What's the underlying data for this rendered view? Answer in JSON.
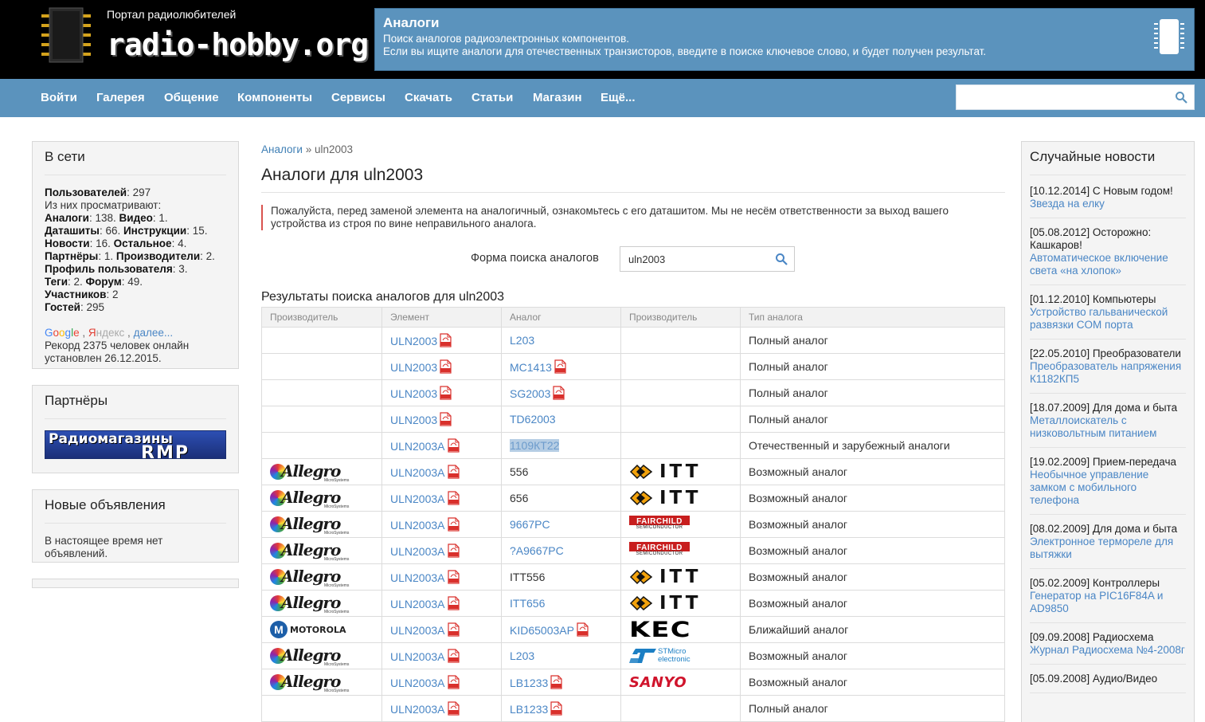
{
  "header": {
    "tagline": "Портал радиолюбителей",
    "site_name": "radio-hobby.org",
    "info_title": "Аналоги",
    "info_line1": "Поиск аналогов радиоэлектронных компонентов.",
    "info_line2": "Если вы ищите аналоги для отечественных транзисторов, введите в поиске ключевое слово, и будет получен результат."
  },
  "nav": {
    "items": [
      "Войти",
      "Галерея",
      "Общение",
      "Компоненты",
      "Сервисы",
      "Скачать",
      "Статьи",
      "Магазин",
      "Ещё..."
    ],
    "search_value": ""
  },
  "online": {
    "title": "В сети",
    "users_label": "Пользователей",
    "users": ": 297",
    "viewing": "Из них просматривают:",
    "l1a": "Аналоги",
    "l1b": ": 138. ",
    "l1c": "Видео",
    "l1d": ": 1.",
    "l2a": "Даташиты",
    "l2b": ": 66. ",
    "l2c": "Инструкции",
    "l2d": ": 15.",
    "l3a": "Новости",
    "l3b": ": 16. ",
    "l3c": "Остальное",
    "l3d": ": 4.",
    "l4a": "Партнёры",
    "l4b": ": 1. ",
    "l4c": "Производители",
    "l4d": ": 2.",
    "l5a": "Профиль пользователя",
    "l5b": ": 3.",
    "l6a": "Теги",
    "l6b": ": 2. ",
    "l6c": "Форум",
    "l6d": ": 49.",
    "l7a": "Участников",
    "l7b": ": 2",
    "l8a": "Гостей",
    "l8b": ": 295",
    "google": "Google",
    "yandex": "Яндекс",
    "more": "далее...",
    "record": "Рекорд 2375 человек онлайн установлен 26.12.2015."
  },
  "partners": {
    "title": "Партнёры",
    "banner_text": "Радиомагазины",
    "banner_sub": "RMP"
  },
  "ads": {
    "title": "Новые объявления",
    "text": "В настоящее время нет объявлений."
  },
  "breadcrumb": {
    "link": "Аналоги",
    "sep": " » ",
    "current": "uln2003"
  },
  "page_title": "Аналоги для uln2003",
  "warning": "Пожалуйста, перед заменой элемента на аналогичный, ознакомьтесь с его даташитом. Мы не несём ответственности за выход вашего устройства из строя по вине неправильного аналога.",
  "search": {
    "label": "Форма поиска аналогов",
    "value": "uln2003"
  },
  "results": {
    "title": "Результаты поиска аналогов для uln2003",
    "columns": [
      "Производитель",
      "Элемент",
      "Аналог",
      "Производитель",
      "Тип аналога"
    ],
    "rows": [
      {
        "mfr": "",
        "el": "ULN2003",
        "an": "L203",
        "an_link": true,
        "an_pdf": false,
        "amfr": "",
        "type": "Полный аналог",
        "tc": "full"
      },
      {
        "mfr": "",
        "el": "ULN2003",
        "an": "MC1413",
        "an_link": true,
        "an_pdf": true,
        "amfr": "",
        "type": "Полный аналог",
        "tc": "full"
      },
      {
        "mfr": "",
        "el": "ULN2003",
        "an": "SG2003",
        "an_link": true,
        "an_pdf": true,
        "amfr": "",
        "type": "Полный аналог",
        "tc": "full"
      },
      {
        "mfr": "",
        "el": "ULN2003",
        "an": "TD62003",
        "an_link": true,
        "an_pdf": false,
        "amfr": "",
        "type": "Полный аналог",
        "tc": "full"
      },
      {
        "mfr": "",
        "el": "ULN2003A",
        "an": "1109КТ22",
        "an_link": true,
        "an_pdf": false,
        "hl": true,
        "amfr": "",
        "type": "Отечественный и зарубежный аналоги",
        "tc": "full"
      },
      {
        "mfr": "allegro",
        "el": "ULN2003A",
        "an": "556",
        "an_link": false,
        "an_pdf": false,
        "amfr": "itt",
        "type": "Возможный аналог",
        "tc": "possible"
      },
      {
        "mfr": "allegro",
        "el": "ULN2003A",
        "an": "656",
        "an_link": false,
        "an_pdf": false,
        "amfr": "itt",
        "type": "Возможный аналог",
        "tc": "possible"
      },
      {
        "mfr": "allegro",
        "el": "ULN2003A",
        "an": "9667PC",
        "an_link": true,
        "an_pdf": false,
        "amfr": "fairchild",
        "type": "Возможный аналог",
        "tc": "possible"
      },
      {
        "mfr": "allegro",
        "el": "ULN2003A",
        "an": "?A9667PC",
        "an_link": true,
        "an_pdf": false,
        "amfr": "fairchild",
        "type": "Возможный аналог",
        "tc": "possible"
      },
      {
        "mfr": "allegro",
        "el": "ULN2003A",
        "an": "ITT556",
        "an_link": false,
        "an_pdf": false,
        "amfr": "itt",
        "type": "Возможный аналог",
        "tc": "possible"
      },
      {
        "mfr": "allegro",
        "el": "ULN2003A",
        "an": "ITT656",
        "an_link": true,
        "an_pdf": false,
        "amfr": "itt",
        "type": "Возможный аналог",
        "tc": "possible"
      },
      {
        "mfr": "motorola",
        "el": "ULN2003A",
        "an": "KID65003AP",
        "an_link": true,
        "an_pdf": true,
        "amfr": "kec",
        "type": "Ближайший аналог",
        "tc": "closest"
      },
      {
        "mfr": "allegro",
        "el": "ULN2003A",
        "an": "L203",
        "an_link": true,
        "an_pdf": false,
        "amfr": "st",
        "type": "Возможный аналог",
        "tc": "possible"
      },
      {
        "mfr": "allegro",
        "el": "ULN2003A",
        "an": "LB1233",
        "an_link": true,
        "an_pdf": true,
        "amfr": "sanyo",
        "type": "Возможный аналог",
        "tc": "possible"
      },
      {
        "mfr": "",
        "el": "ULN2003A",
        "an": "LB1233",
        "an_link": true,
        "an_pdf": true,
        "amfr": "",
        "type": "Полный аналог",
        "tc": "full"
      }
    ]
  },
  "logos": {
    "allegro": "Allegro",
    "allegro_sub": "MicroSystems",
    "itt": "ITT",
    "fairchild": "FAIRCHILD",
    "fairchild_sub": "SEMICONDUCTOR",
    "kec": "KEC",
    "st_line1": "STMicro",
    "st_line2": "electronic",
    "sanyo": "SANYO",
    "motorola": "MOTOROLA"
  },
  "news": {
    "title": "Случайные новости",
    "items": [
      {
        "meta": "[10.12.2014] С Новым годом!",
        "link": "Звезда на елку"
      },
      {
        "meta": "[05.08.2012] Осторожно: Кашкаров!",
        "link": "Автоматическое включение света «на хлопок»"
      },
      {
        "meta": "[01.12.2010] Компьютеры",
        "link": "Устройство гальванической развязки COM порта"
      },
      {
        "meta": "[22.05.2010] Преобразователи",
        "link": "Преобразователь напряжения К1182КП5"
      },
      {
        "meta": "[18.07.2009] Для дома и быта",
        "link": "Металлоискатель с низковольтным питанием"
      },
      {
        "meta": "[19.02.2009] Прием-передача",
        "link": "Необычное управление замком с мобильного телефона"
      },
      {
        "meta": "[08.02.2009] Для дома и быта",
        "link": "Электронное термореле для вытяжки"
      },
      {
        "meta": "[05.02.2009] Контроллеры",
        "link": "Генератор на PIC16F84A и AD9850"
      },
      {
        "meta": "[09.09.2008] Радиосхема",
        "link": "Журнал Радиосхема №4-2008г"
      },
      {
        "meta": "[05.09.2008] Аудио/Видео",
        "link": ""
      }
    ]
  },
  "colors": {
    "header_blue": "#5b93bd",
    "link": "#4a86c5",
    "full": "#3a8f26",
    "possible": "#b02a2a",
    "closest": "#8a8a1e"
  }
}
